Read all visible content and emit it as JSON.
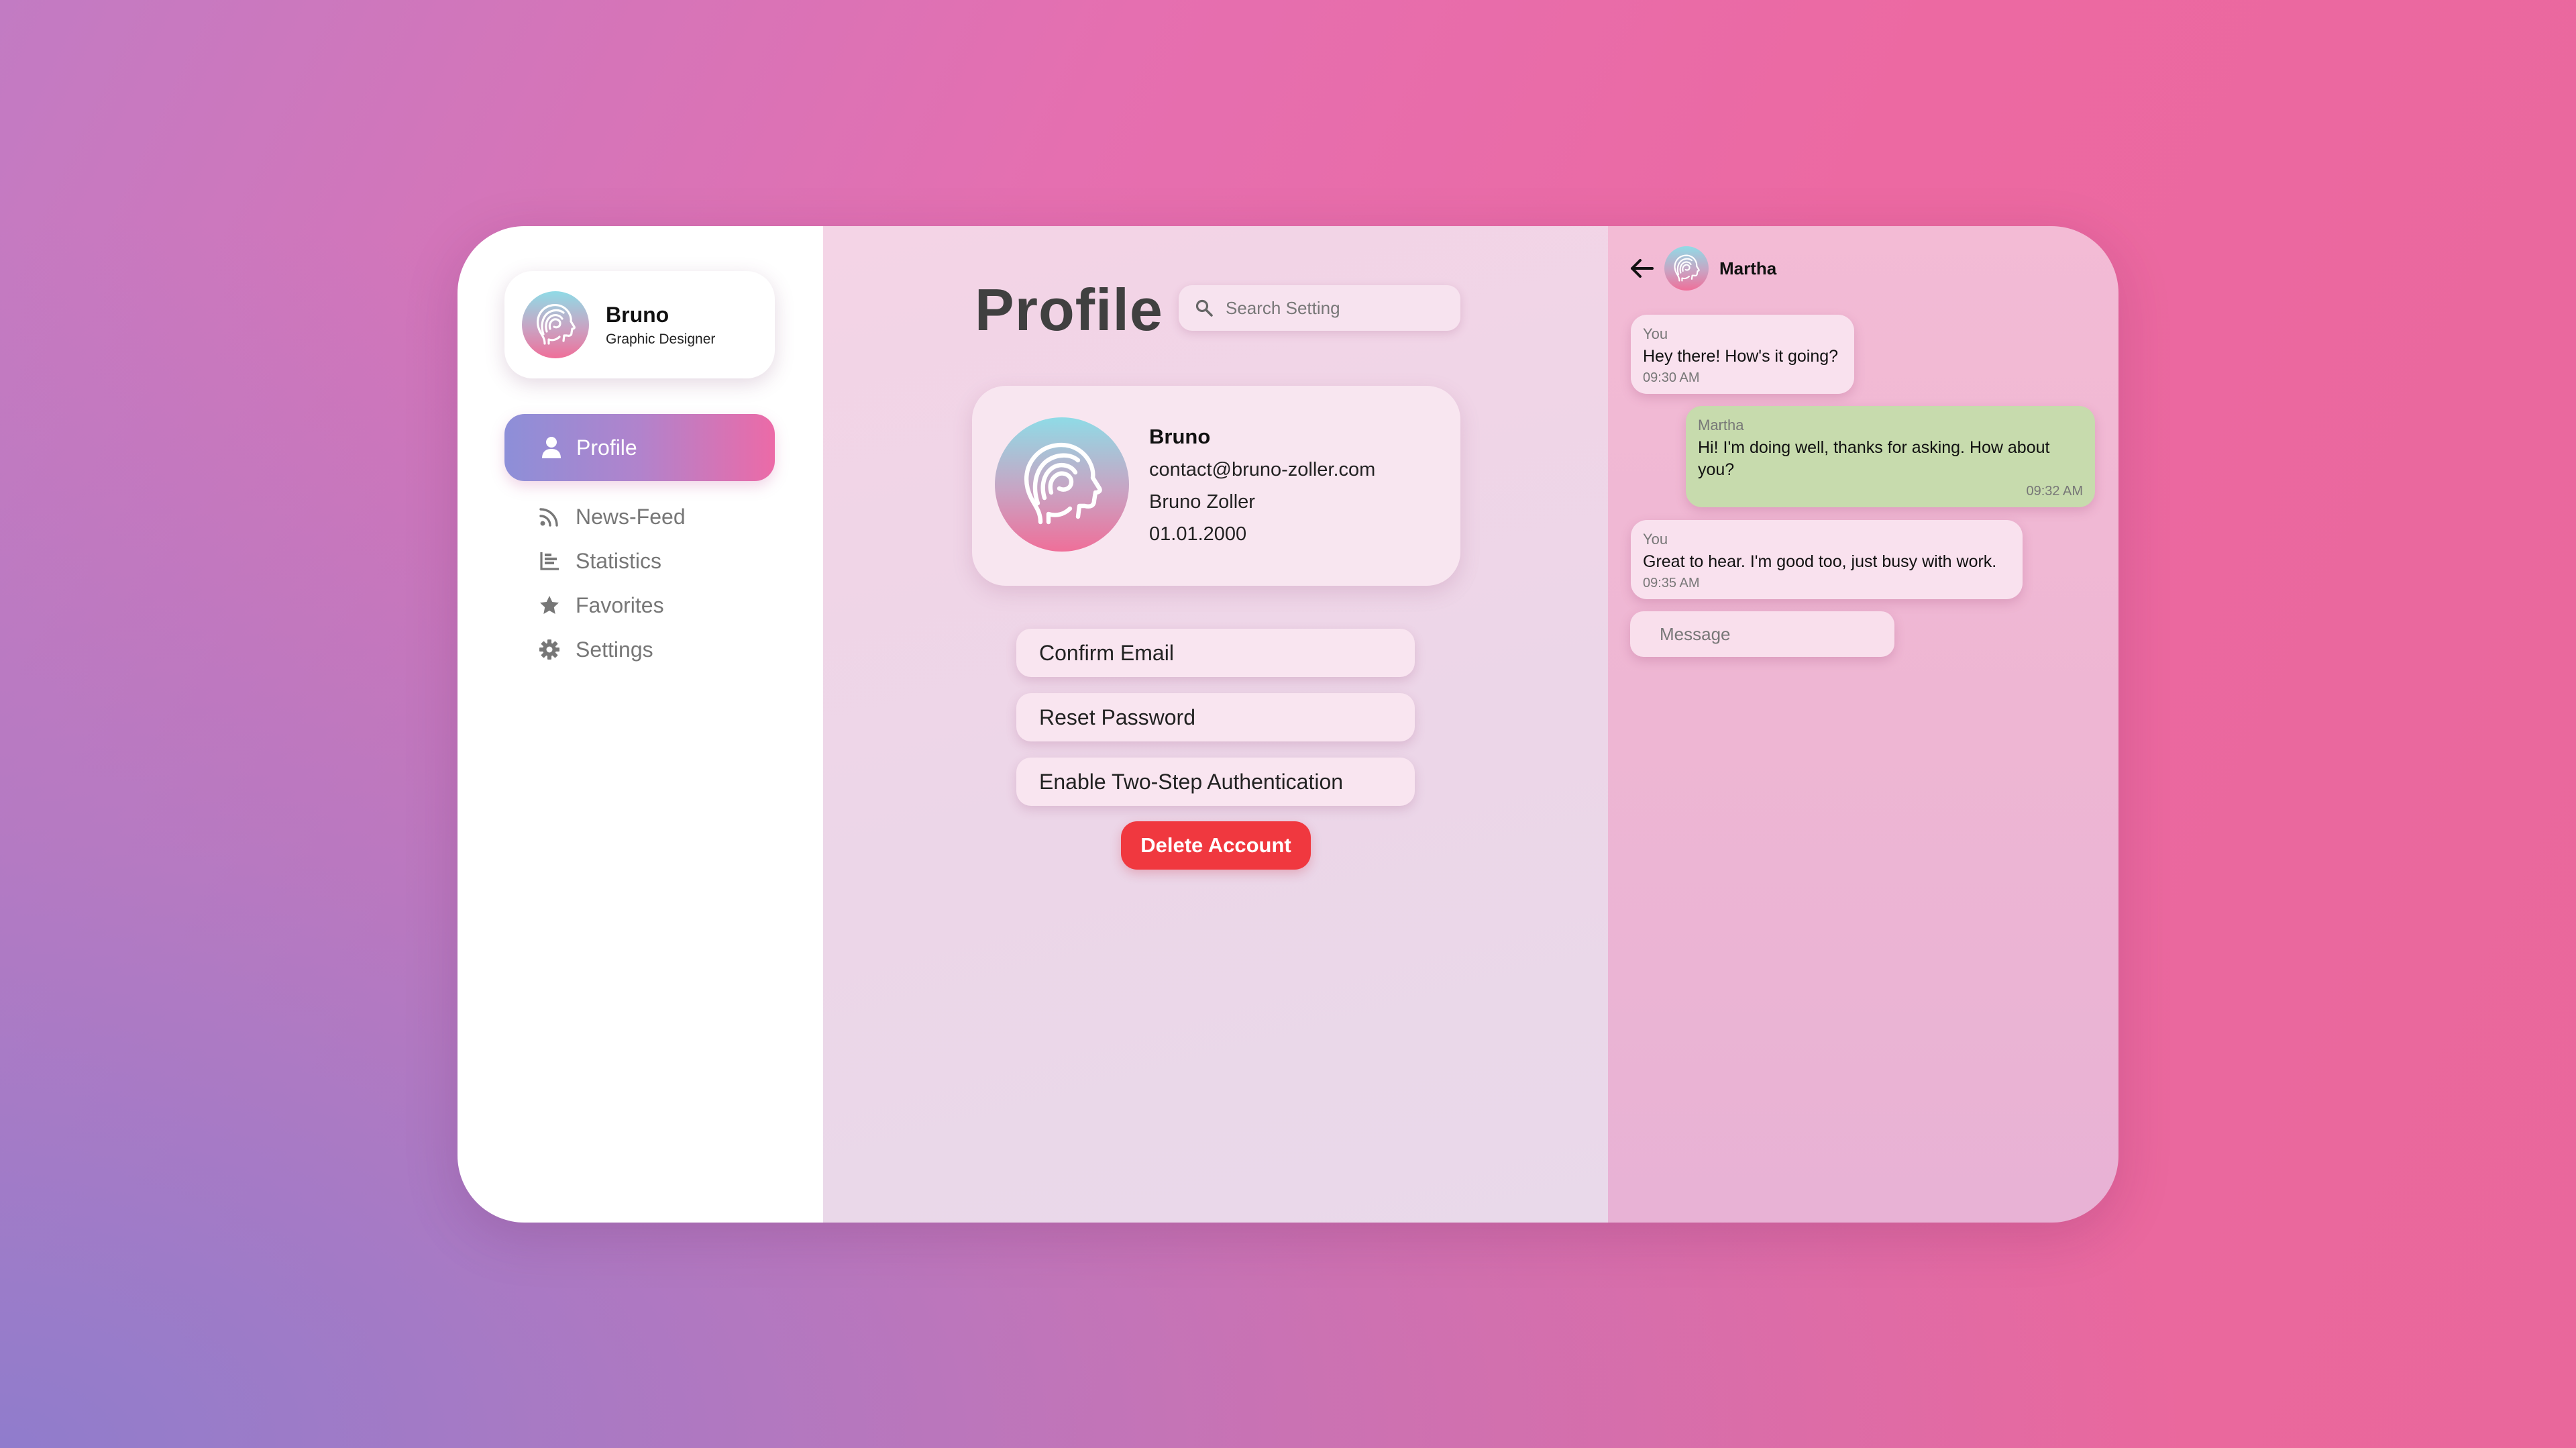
{
  "colors": {
    "accent_gradient_start": "#8d8fd8",
    "accent_gradient_end": "#ec6aa7",
    "danger": "#f0383f",
    "incoming_bubble": "#c7dbad",
    "outgoing_bubble": "#f9e1ee"
  },
  "user": {
    "name": "Bruno",
    "role": "Graphic Designer",
    "avatar_icon": "head-profile-icon"
  },
  "sidebar": {
    "active_item": {
      "label": "Profile",
      "icon": "user-icon"
    },
    "items": [
      {
        "label": "News-Feed",
        "icon": "rss-icon"
      },
      {
        "label": "Statistics",
        "icon": "bar-chart-icon"
      },
      {
        "label": "Favorites",
        "icon": "star-icon"
      },
      {
        "label": "Settings",
        "icon": "gear-icon"
      }
    ]
  },
  "main": {
    "title": "Profile",
    "search": {
      "placeholder": "Search Setting",
      "icon": "search-icon"
    },
    "profile": {
      "name": "Bruno",
      "email": "contact@bruno-zoller.com",
      "full_name": "Bruno Zoller",
      "birthdate": "01.01.2000"
    },
    "actions": {
      "confirm_email": "Confirm Email",
      "reset_password": "Reset Password",
      "two_step": "Enable Two-Step Authentication",
      "delete": "Delete Account"
    }
  },
  "chat": {
    "contact": "Martha",
    "messages": [
      {
        "sender": "You",
        "text": "Hey there! How's it going?",
        "time": "09:30 AM"
      },
      {
        "sender": "Martha",
        "text": "Hi! I'm doing well, thanks for asking. How about you?",
        "time": "09:32 AM"
      },
      {
        "sender": "You",
        "text": "Great to hear. I'm good too, just busy with work.",
        "time": "09:35 AM"
      }
    ],
    "input_placeholder": "Message"
  }
}
